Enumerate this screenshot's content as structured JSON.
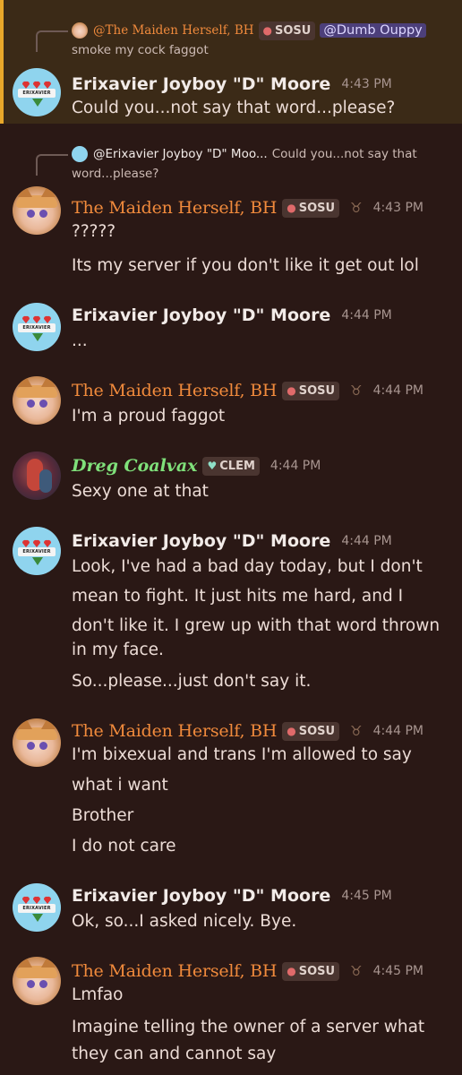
{
  "colors": {
    "background": "#2a1815",
    "highlight": "#3b2a17",
    "highlight_bar": "#e8a72a",
    "maiden_name": "#f08a3c",
    "dreg_name": "#7fe07a"
  },
  "reply1": {
    "author": "@The Maiden Herself, BH",
    "tag": "SOSU",
    "mention": "@Dumb Ouppy",
    "text": "smoke my cock faggot"
  },
  "reply2": {
    "author": "@Erixavier Joyboy \"D\" Moo...",
    "text_a": "Could you...not say that",
    "text_b": "word...please?"
  },
  "messages": [
    {
      "name": "Erixavier Joyboy \"D\" Moore",
      "time": "4:43 PM",
      "lines": [
        "Could you...not say that word...please?"
      ]
    },
    {
      "name": "The Maiden Herself, BH",
      "tag": "SOSU",
      "time": "4:43 PM",
      "lines": [
        "?????",
        "Its my server if you don't like it get out lol"
      ]
    },
    {
      "name": "Erixavier Joyboy \"D\" Moore",
      "time": "4:44 PM",
      "lines": [
        "..."
      ]
    },
    {
      "name": "The Maiden Herself, BH",
      "tag": "SOSU",
      "time": "4:44 PM",
      "lines": [
        "I'm a proud faggot"
      ]
    },
    {
      "name": "Dreg Coalvax",
      "tag": "CLEM",
      "time": "4:44 PM",
      "lines": [
        "Sexy one at that"
      ]
    },
    {
      "name": "Erixavier Joyboy \"D\" Moore",
      "time": "4:44 PM",
      "lines": [
        "Look, I've had a bad day today, but I don't",
        "mean to fight. It just hits me hard, and I",
        "don't like it. I grew up with that word thrown",
        "in my face.",
        "So...please...just don't say it."
      ]
    },
    {
      "name": "The Maiden Herself, BH",
      "tag": "SOSU",
      "time": "4:44 PM",
      "lines": [
        "I'm bixexual and trans I'm allowed to say",
        "what i want",
        "Brother",
        "I do not care"
      ]
    },
    {
      "name": "Erixavier Joyboy \"D\" Moore",
      "time": "4:45 PM",
      "lines": [
        "Ok, so...I asked nicely. Bye."
      ]
    },
    {
      "name": "The Maiden Herself, BH",
      "tag": "SOSU",
      "time": "4:45 PM",
      "lines": [
        "Lmfao",
        "Imagine telling the owner of a server what",
        "they can and cannot say"
      ]
    }
  ],
  "avatar_text": "ERIXAVIER"
}
